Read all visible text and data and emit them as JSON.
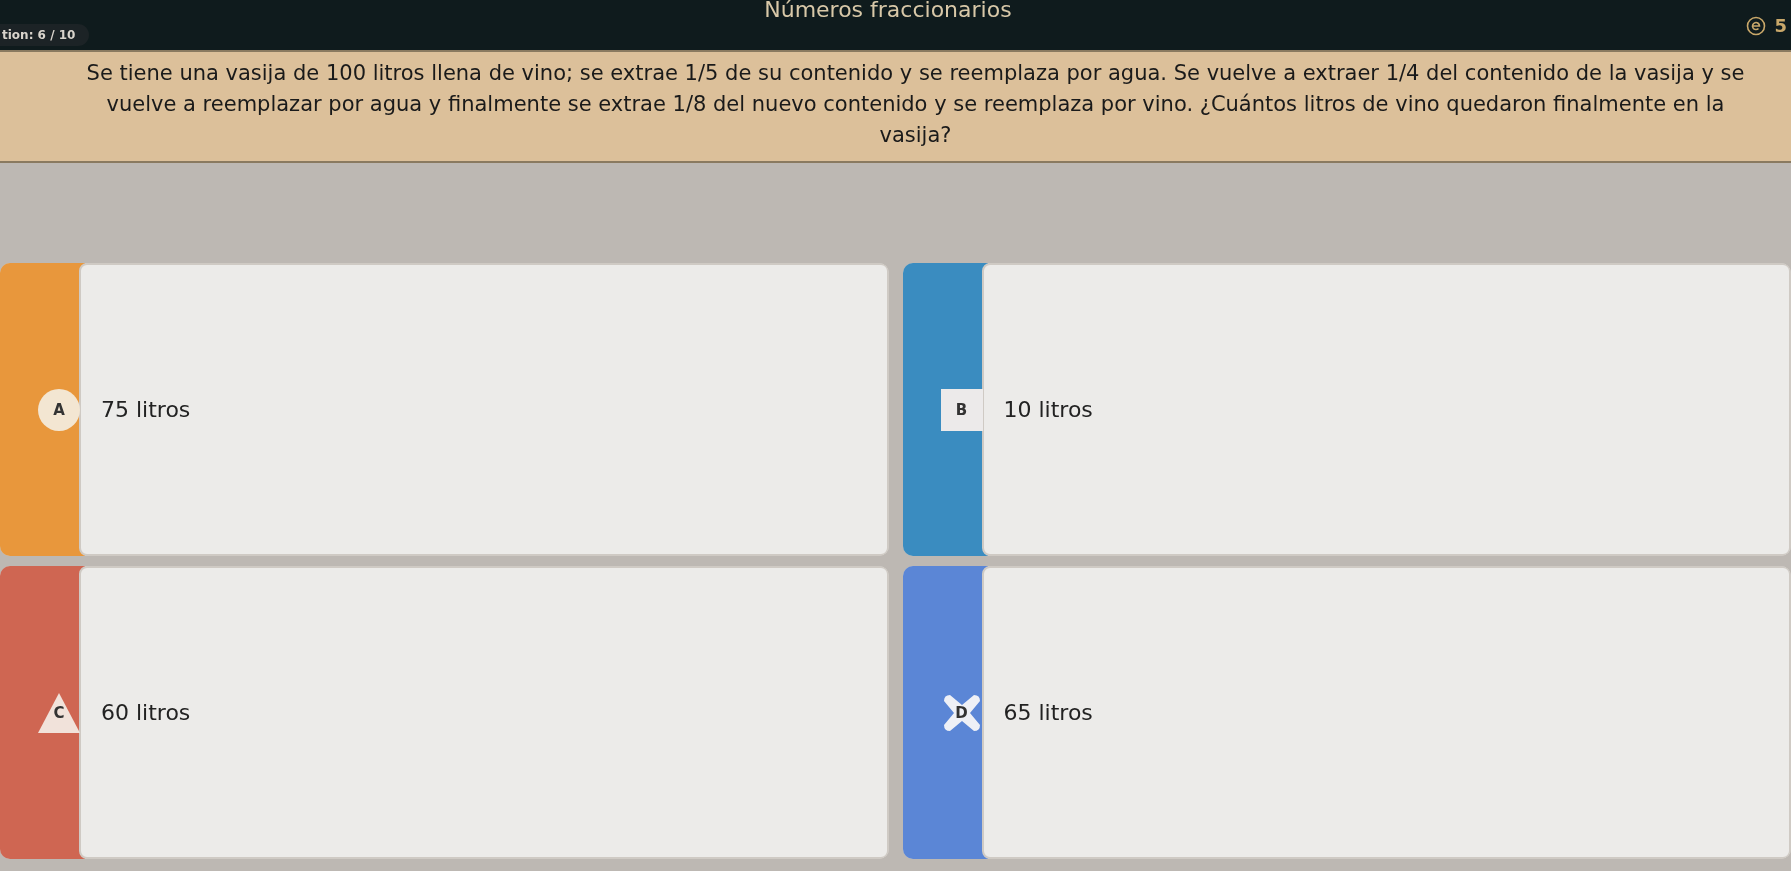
{
  "header": {
    "title": "Números fraccionarios",
    "question_counter": "tion: 6 / 10",
    "score": "5"
  },
  "question": "Se tiene una vasija de 100 litros llena de vino; se extrae 1/5 de su contenido y se reemplaza por agua. Se vuelve a extraer 1/4 del contenido de la vasija y se vuelve a reemplazar por agua y finalmente se extrae 1/8 del nuevo contenido y se reemplaza por vino. ¿Cuántos litros de vino quedaron finalmente en la vasija?",
  "answers": [
    {
      "letter": "A",
      "text": "75 litros",
      "kind": "circle",
      "color": "#e8973c"
    },
    {
      "letter": "B",
      "text": "10 litros",
      "kind": "square",
      "color": "#3a8cc0"
    },
    {
      "letter": "C",
      "text": "60 litros",
      "kind": "triangle",
      "color": "#cf6652"
    },
    {
      "letter": "D",
      "text": "65 litros",
      "kind": "cross",
      "color": "#5b86d6"
    }
  ]
}
